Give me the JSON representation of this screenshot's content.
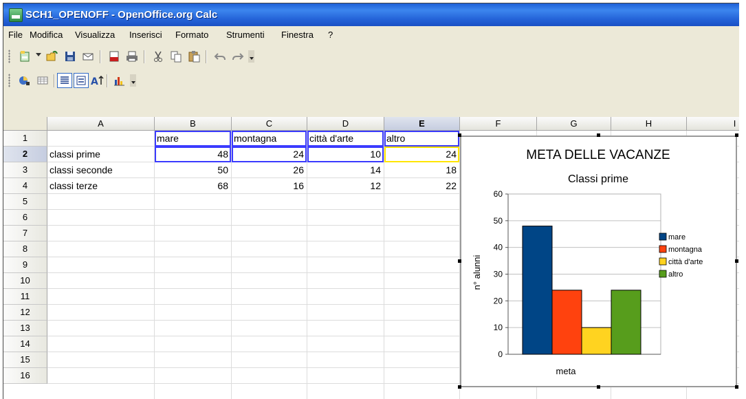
{
  "window": {
    "title": "SCH1_OPENOFF - OpenOffice.org Calc"
  },
  "menu": [
    "File",
    "Modifica",
    "Visualizza",
    "Inserisci",
    "Formato",
    "Strumenti",
    "Finestra",
    "?"
  ],
  "toolbar1": [
    "new-icon",
    "open-icon",
    "save-icon",
    "email-icon",
    "export-pdf-icon",
    "print-icon",
    "cut-icon",
    "copy-icon",
    "paste-icon",
    "undo-icon",
    "redo-icon"
  ],
  "toolbar2": [
    "chart-wizard-icon",
    "table-icon",
    "text-mode-icon",
    "list-mode-icon",
    "chart-text-icon",
    "chart-type-icon"
  ],
  "columns": [
    "A",
    "B",
    "C",
    "D",
    "E",
    "F",
    "G",
    "H",
    "I"
  ],
  "rows": [
    "1",
    "2",
    "3",
    "4",
    "5",
    "6",
    "7",
    "8",
    "9",
    "10",
    "11",
    "12",
    "13",
    "14",
    "15",
    "16"
  ],
  "cells": {
    "B1": "mare",
    "C1": "montagna",
    "D1": "città d'arte",
    "E1": "altro",
    "A2": "classi prime",
    "B2": "48",
    "C2": "24",
    "D2": "10",
    "E2": "24",
    "A3": "classi seconde",
    "B3": "50",
    "C3": "26",
    "D3": "14",
    "E3": "18",
    "A4": "classi terze",
    "B4": "68",
    "C4": "16",
    "D4": "12",
    "E4": "22"
  },
  "chart_data": {
    "type": "bar",
    "title": "META DELLE VACANZE",
    "subtitle": "Classi prime",
    "xlabel": "meta",
    "ylabel": "n° alunni",
    "categories": [
      "meta"
    ],
    "series": [
      {
        "name": "mare",
        "values": [
          48
        ],
        "color": "#004586"
      },
      {
        "name": "montagna",
        "values": [
          24
        ],
        "color": "#ff420e"
      },
      {
        "name": "città d'arte",
        "values": [
          10
        ],
        "color": "#ffd320"
      },
      {
        "name": "altro",
        "values": [
          24
        ],
        "color": "#579d1c"
      }
    ],
    "ylim": [
      0,
      60
    ],
    "yticks": [
      "0",
      "10",
      "20",
      "30",
      "40",
      "50",
      "60"
    ],
    "grid": true,
    "legend": "right"
  }
}
